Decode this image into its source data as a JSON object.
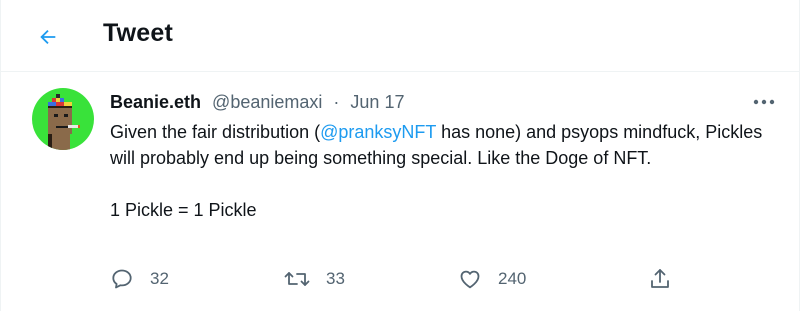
{
  "header": {
    "title": "Tweet",
    "back_icon": "back-arrow-icon",
    "accent_color": "#1d9bf0"
  },
  "tweet": {
    "author": {
      "display_name": "Beanie.eth",
      "handle": "@beaniemaxi",
      "avatar_bg": "#39e23a"
    },
    "separator": "·",
    "date": "Jun 17",
    "more_icon": "more-horizontal-icon",
    "body": {
      "p1_before": "Given the fair distribution (",
      "mention": "@pranksyNFT",
      "p1_after": " has none) and psyops mindfuck, Pickles will probably end up being something special. Like the Doge of NFT.",
      "p2": "1 Pickle = 1 Pickle"
    },
    "actions": {
      "reply": {
        "icon": "reply-icon",
        "count": "32"
      },
      "retweet": {
        "icon": "retweet-icon",
        "count": "33"
      },
      "like": {
        "icon": "heart-icon",
        "count": "240"
      },
      "share": {
        "icon": "share-icon"
      }
    }
  }
}
